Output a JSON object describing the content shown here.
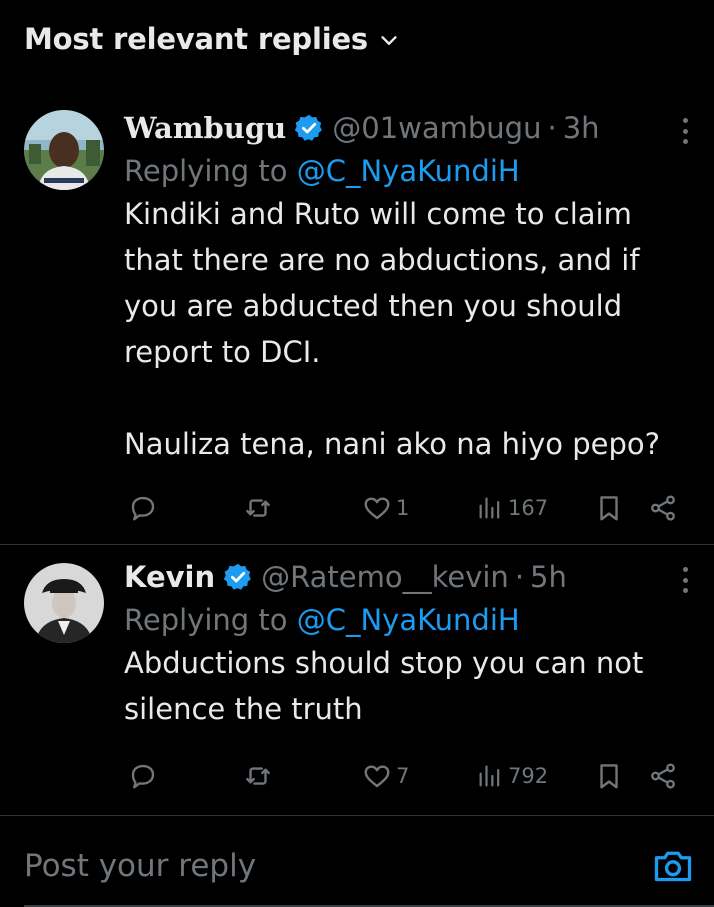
{
  "header": {
    "sort_label": "Most relevant replies"
  },
  "replies": [
    {
      "name": "Wambugu",
      "handle": "@01wambugu",
      "separator": "·",
      "time": "3h",
      "replying_prefix": "Replying to ",
      "replying_to": "@C_NyaKundiH",
      "lines": [
        "Kindiki and Ruto will come to claim",
        "that there are no abductions, and if",
        "you are abducted then you should",
        "report to DCI."
      ],
      "lines2": [
        "Nauliza tena, nani ako na hiyo pepo?"
      ],
      "likes": "1",
      "views": "167"
    },
    {
      "name": "Kevin",
      "handle": "@Ratemo__kevin",
      "separator": "·",
      "time": "5h",
      "replying_prefix": "Replying to ",
      "replying_to": "@C_NyaKundiH",
      "lines": [
        "Abductions should stop you can not",
        "silence the truth"
      ],
      "likes": "7",
      "views": "792"
    }
  ],
  "composer": {
    "placeholder": "Post your reply"
  },
  "colors": {
    "accent": "#1d9bf0",
    "muted": "#71767b",
    "text": "#e7e9ea",
    "background": "#000000",
    "divider": "#2f3336"
  }
}
